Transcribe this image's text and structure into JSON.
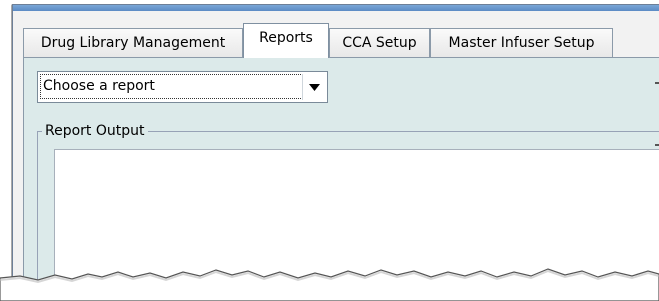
{
  "tabs": [
    {
      "label": "Drug Library Management",
      "active": false
    },
    {
      "label": "Reports",
      "active": true
    },
    {
      "label": "CCA Setup",
      "active": false
    },
    {
      "label": "Master Infuser Setup",
      "active": false
    }
  ],
  "report_select": {
    "value": "Choose a report",
    "arrow_icon": "chevron-down-icon"
  },
  "report_output": {
    "legend": "Report Output",
    "content": ""
  },
  "colors": {
    "content_bg": "#dceaea",
    "tab_border": "#8b9aa9",
    "window_frame": "#6d7f97"
  }
}
